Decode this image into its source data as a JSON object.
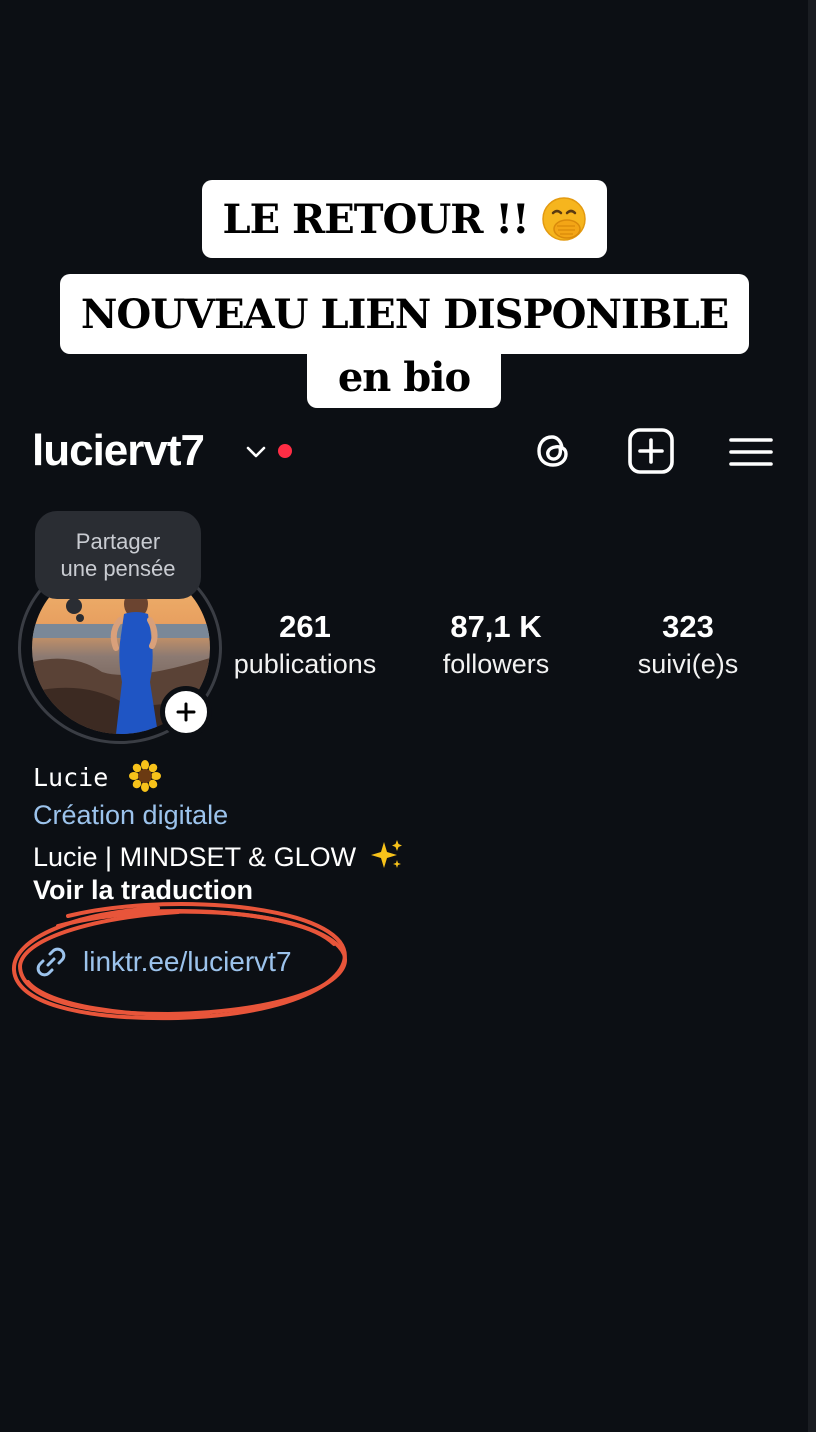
{
  "overlay": {
    "line1": "LE RETOUR !!",
    "line1_emoji": "face-with-hand-over-mouth",
    "line2": "NOUVEAU LIEN DISPONIBLE",
    "line3": "en bio"
  },
  "header": {
    "username": "luciervt7",
    "icons": [
      "chevron-down-icon",
      "threads-icon",
      "add-post-icon",
      "menu-icon"
    ],
    "notification_color": "#ff2d45"
  },
  "profile": {
    "thought_bubble": "Partager\nune pensée",
    "stats": [
      {
        "value": "261",
        "label": "publications"
      },
      {
        "value": "87,1 K",
        "label": "followers"
      },
      {
        "value": "323",
        "label": "suivi(e)s"
      }
    ],
    "name": "Lucie",
    "name_emoji": "sunflower",
    "category": "Création digitale",
    "bio": "Lucie | MINDSET & GLOW",
    "bio_emoji": "sparkles",
    "translate": "Voir la traduction",
    "link": "linktr.ee/luciervt7"
  },
  "colors": {
    "background": "#0c0f14",
    "link": "#9cc3ec",
    "highlight_circle": "#e8553a"
  }
}
